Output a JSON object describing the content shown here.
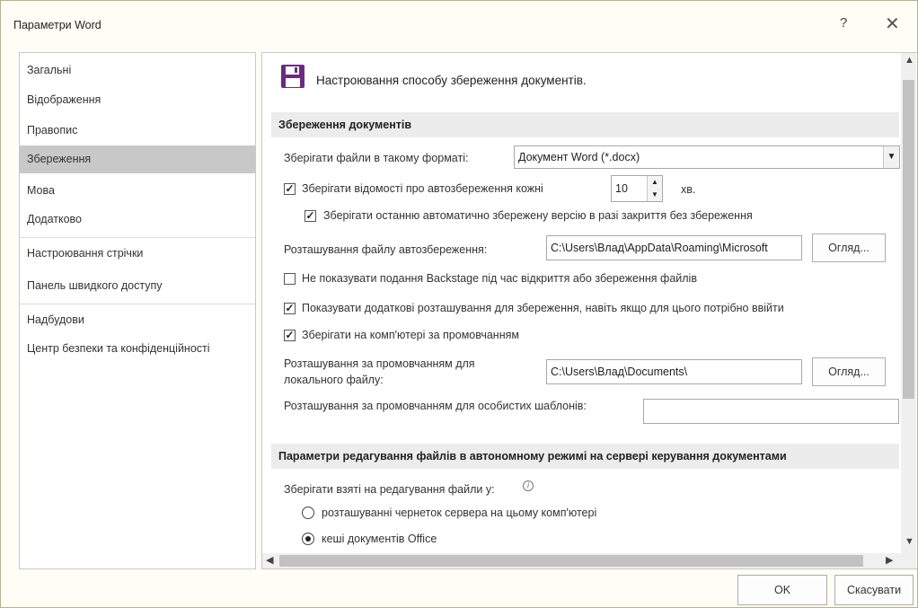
{
  "window": {
    "title": "Параметри Word",
    "help_label": "?",
    "close_label": "✕"
  },
  "sidebar": {
    "items": [
      {
        "label": "Загальні"
      },
      {
        "label": "Відображення"
      },
      {
        "label": "Правопис"
      },
      {
        "label": "Збереження",
        "selected": true
      },
      {
        "label": "Мова"
      },
      {
        "label": "Додатково"
      },
      {
        "label": "Настроювання стрічки"
      },
      {
        "label": "Панель швидкого доступу"
      },
      {
        "label": "Надбудови"
      },
      {
        "label": "Центр безпеки та конфіденційності"
      }
    ]
  },
  "header": {
    "icon": "save-icon",
    "title": "Настроювання способу збереження документів."
  },
  "save_docs": {
    "section_title": "Збереження документів",
    "format_label": "Зберігати файли в такому форматі:",
    "format_value": "Документ Word (*.docx)",
    "autosave_label": "Зберігати відомості про автозбереження кожні",
    "autosave_checked": true,
    "autosave_minutes": "10",
    "autosave_unit": "хв.",
    "keep_last_label": "Зберігати останню автоматично збережену версію в разі закриття без збереження",
    "keep_last_checked": true,
    "autorecover_location_label": "Розташування файлу автозбереження:",
    "autorecover_location_value": "C:\\Users\\Влад\\AppData\\Roaming\\Microsoft",
    "browse_label_1": "Огляд...",
    "no_backstage_label": "Не показувати подання Backstage під час відкриття або збереження файлів",
    "no_backstage_checked": false,
    "show_additional_label": "Показувати додаткові розташування для збереження, навіть якщо для цього потрібно ввійти",
    "show_additional_checked": true,
    "save_to_computer_label": "Зберігати на комп'ютері за промовчанням",
    "save_to_computer_checked": true,
    "local_location_label": "Розташування за промовчанням для локального файлу:",
    "local_location_value": "C:\\Users\\Влад\\Documents\\",
    "browse_label_2": "Огляд...",
    "templates_location_label": "Розташування за промовчанням для особистих шаблонів:",
    "templates_location_value": ""
  },
  "offline_editing": {
    "section_title": "Параметри редагування файлів в автономному режимі на сервері керування документами",
    "save_checked_out_label": "Зберігати взяті на редагування файли у:",
    "info_icon": "info-icon",
    "options": [
      {
        "label": "розташуванні чернеток сервера на цьому комп'ютері",
        "selected": false
      },
      {
        "label": "кеші документів Office",
        "selected": true
      }
    ]
  },
  "footer": {
    "ok_label": "OK",
    "cancel_label": "Скасувати"
  }
}
